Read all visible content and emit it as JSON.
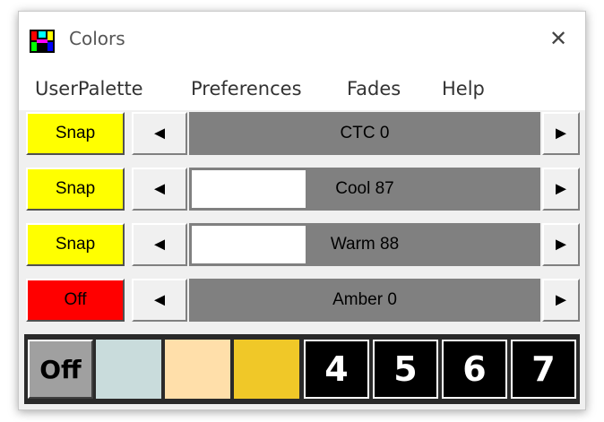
{
  "window": {
    "title": "Colors",
    "close_glyph": "✕"
  },
  "menu": {
    "items": [
      "UserPalette",
      "Preferences",
      "Fades",
      "Help"
    ]
  },
  "rows": [
    {
      "button": "Snap",
      "button_color": "#ffff00",
      "left_arrow": "◄",
      "right_arrow": "►",
      "label": "CTC 0",
      "level": 0
    },
    {
      "button": "Snap",
      "button_color": "#ffff00",
      "left_arrow": "◄",
      "right_arrow": "►",
      "label": "Cool 87",
      "level": 0.87
    },
    {
      "button": "Snap",
      "button_color": "#ffff00",
      "left_arrow": "◄",
      "right_arrow": "►",
      "label": "Warm 88",
      "level": 0.88
    },
    {
      "button": "Off",
      "button_color": "#ff0000",
      "left_arrow": "◄",
      "right_arrow": "►",
      "label": "Amber 0",
      "level": 0
    }
  ],
  "palette": [
    {
      "label": "Off",
      "color": "#a0a0a0"
    },
    {
      "label": "",
      "color": "#c9dcdc"
    },
    {
      "label": "",
      "color": "#ffdfaa"
    },
    {
      "label": "",
      "color": "#f0c828"
    },
    {
      "label": "4",
      "color": "#000000"
    },
    {
      "label": "5",
      "color": "#000000"
    },
    {
      "label": "6",
      "color": "#000000"
    },
    {
      "label": "7",
      "color": "#000000"
    }
  ]
}
